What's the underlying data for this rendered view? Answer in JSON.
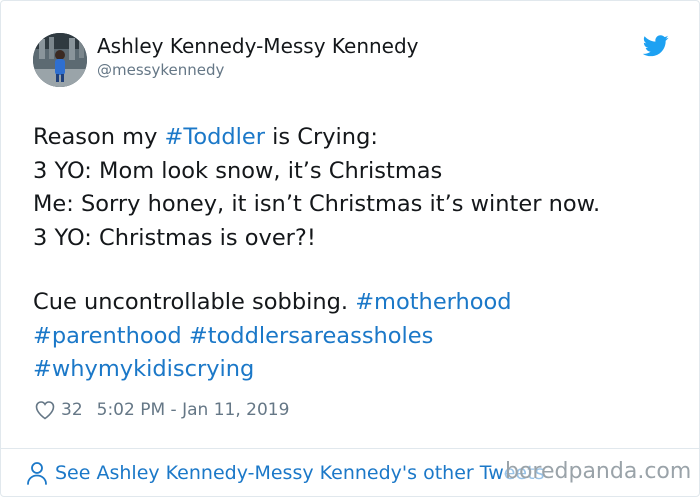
{
  "author": {
    "display_name": "Ashley Kennedy-Messy Kennedy",
    "handle": "@messykennedy"
  },
  "icons": {
    "brand": "twitter-bird-icon",
    "like": "heart-icon",
    "footer": "person-icon"
  },
  "colors": {
    "link": "#1b78c8",
    "text": "#14171a",
    "muted": "#657786",
    "brand": "#1da1f2"
  },
  "tweet": {
    "line1_prefix": "Reason my ",
    "line1_tag": "#Toddler",
    "line1_suffix": " is Crying:",
    "line2": "3 YO: Mom look snow, it’s Christmas",
    "line3": "Me: Sorry honey, it isn’t Christmas it’s winter now.",
    "line4": "3 YO: Christmas is over?!",
    "line5_text": "Cue uncontrollable sobbing. ",
    "hashtags": [
      "#motherhood",
      "#parenthood",
      "#toddlersareassholes",
      "#whymykidiscrying"
    ]
  },
  "meta": {
    "likes": "32",
    "timestamp": "5:02 PM - Jan 11, 2019"
  },
  "footer": {
    "label": "See Ashley Kennedy-Messy Kennedy's other Tweets"
  },
  "watermark": "boredpanda.com"
}
